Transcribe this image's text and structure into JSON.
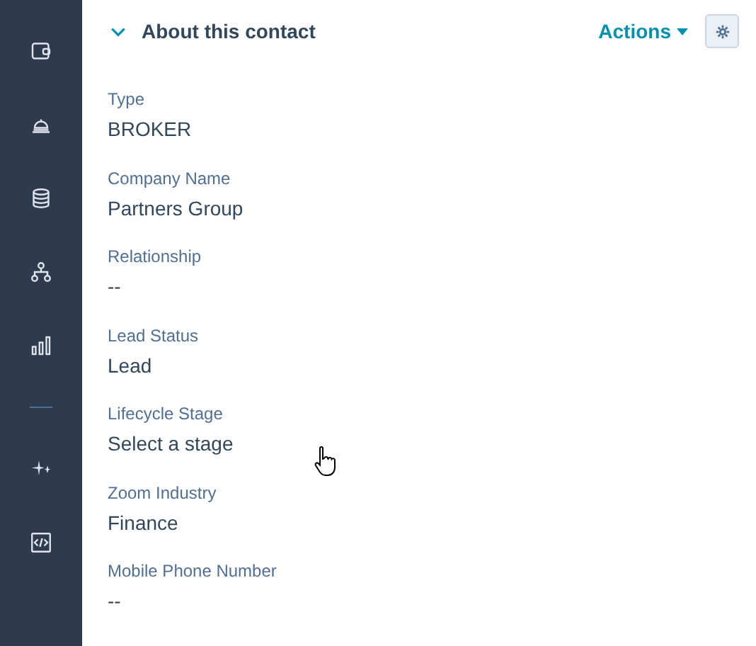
{
  "sidebar": {
    "items": [
      {
        "kind": "wallet"
      },
      {
        "kind": "bell"
      },
      {
        "kind": "database"
      },
      {
        "kind": "hierarchy"
      },
      {
        "kind": "chart"
      },
      {
        "kind": "divider"
      },
      {
        "kind": "sparkle"
      },
      {
        "kind": "code"
      }
    ]
  },
  "section": {
    "title": "About this contact",
    "expanded": true,
    "actions_label": "Actions"
  },
  "fields": [
    {
      "label": "Type",
      "value": "BROKER"
    },
    {
      "label": "Company Name",
      "value": "Partners Group"
    },
    {
      "label": "Relationship",
      "value": "--"
    },
    {
      "label": "Lead Status",
      "value": "Lead"
    },
    {
      "label": "Lifecycle Stage",
      "value": "Select a stage"
    },
    {
      "label": "Zoom Industry",
      "value": "Finance"
    },
    {
      "label": "Mobile Phone Number",
      "value": "--"
    }
  ]
}
